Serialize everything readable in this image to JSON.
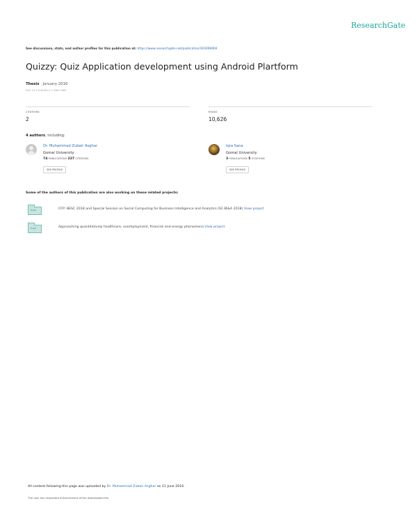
{
  "brand": "ResearchGate",
  "discussion": {
    "text": "See discussions, stats, and author profiles for this publication at:",
    "url": "https://www.researchgate.net/publication/303096069"
  },
  "title": "Quizzy: Quiz Application development using Android Plartform",
  "meta": {
    "type": "Thesis",
    "date": "· January 2016"
  },
  "doi": "DOI: 10.13140/RG.2.1.3385.3369",
  "stats": {
    "citations_label": "CITATIONS",
    "citations": "2",
    "reads_label": "READS",
    "reads": "10,626"
  },
  "authors_header": {
    "count": "4 authors",
    "suffix": ", including:"
  },
  "authors": [
    {
      "name": "Dr. Muhammad Zubair Asghar",
      "affiliation": "Gomal University",
      "publications": "74",
      "pub_label": "PUBLICATIONS",
      "citations": "227",
      "cit_label": "CITATIONS",
      "button": "SEE PROFILE"
    },
    {
      "name": "Iqra Sana",
      "affiliation": "Gomal University",
      "publications": "3",
      "pub_label": "PUBLICATIONS",
      "citations": "5",
      "cit_label": "CITATIONS",
      "button": "SEE PROFILE"
    }
  ],
  "projects_header": "Some of the authors of this publication are also working on these related projects:",
  "projects": [
    {
      "icon_label": "Project",
      "text": "CFP: BESC 2018 and Special Session on Social Computing for Business Intelligence and Analytics (SC-BI&A 2018)",
      "link": "View project"
    },
    {
      "icon_label": "Project",
      "text": "Approaching quantitatively healthcare, unemployment, financial and energy phenomena",
      "link": "View project"
    }
  ],
  "footer": {
    "uploaded_prefix": "All content following this page was uploaded by",
    "uploader": "Dr. Muhammad Zubair Asghar",
    "uploaded_suffix": "on 11 June 2016.",
    "note": "The user has requested enhancement of the downloaded file."
  },
  "colors": {
    "brand": "#1aa698",
    "link": "#2f6db5"
  }
}
